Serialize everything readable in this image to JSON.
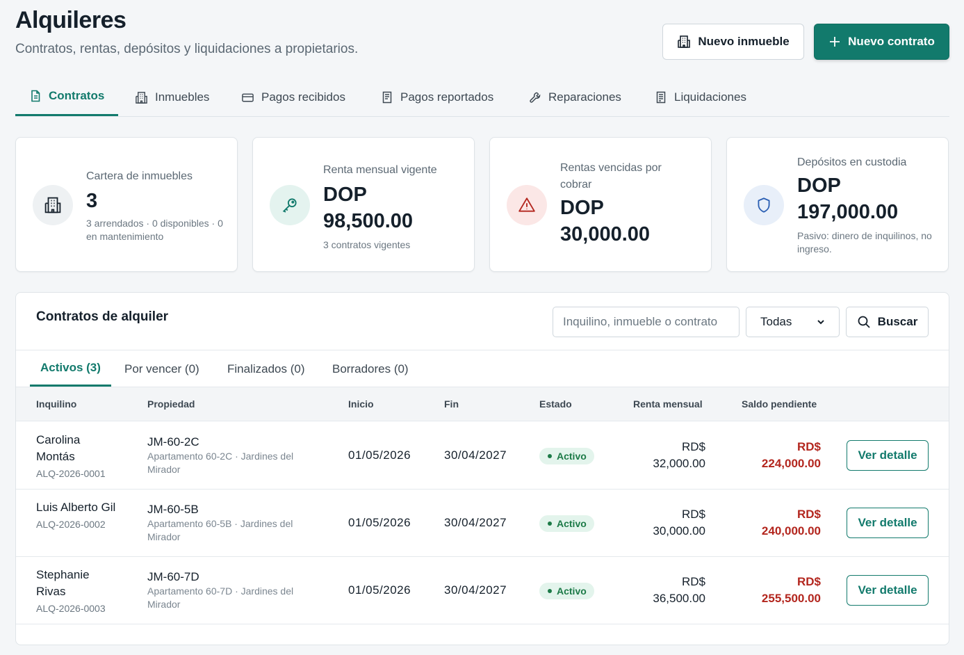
{
  "header": {
    "title": "Alquileres",
    "subtitle": "Contratos, rentas, depósitos y liquidaciones a propietarios.",
    "new_property_label": "Nuevo inmueble",
    "new_contract_label": "Nuevo contrato"
  },
  "tabs": [
    {
      "label": "Contratos",
      "icon": "document-icon",
      "active": true
    },
    {
      "label": "Inmuebles",
      "icon": "building-icon",
      "active": false
    },
    {
      "label": "Pagos recibidos",
      "icon": "credit-card-icon",
      "active": false
    },
    {
      "label": "Pagos reportados",
      "icon": "receipt-icon",
      "active": false
    },
    {
      "label": "Reparaciones",
      "icon": "wrench-icon",
      "active": false
    },
    {
      "label": "Liquidaciones",
      "icon": "document-list-icon",
      "active": false
    }
  ],
  "cards": [
    {
      "label": "Cartera de inmuebles",
      "value": "3",
      "note": "3 arrendados · 0 disponibles · 0 en mantenimiento",
      "icon": "building-icon"
    },
    {
      "label": "Renta mensual vigente",
      "value": "DOP 98,500.00",
      "note": "3 contratos vigentes",
      "icon": "key-icon"
    },
    {
      "label": "Rentas vencidas por cobrar",
      "value": "DOP 30,000.00",
      "note": "",
      "icon": "warning-icon"
    },
    {
      "label": "Depósitos en custodia",
      "value": "DOP 197,000.00",
      "note": "Pasivo: dinero de inquilinos, no ingreso.",
      "icon": "shield-icon"
    }
  ],
  "contracts_panel": {
    "title": "Contratos de alquiler",
    "search_placeholder": "Inquilino, inmueble o contrato",
    "filter_value": "Todas",
    "search_button": "Buscar",
    "subtabs": [
      {
        "label": "Activos (3)",
        "active": true
      },
      {
        "label": "Por vencer (0)",
        "active": false
      },
      {
        "label": "Finalizados (0)",
        "active": false
      },
      {
        "label": "Borradores (0)",
        "active": false
      }
    ],
    "columns": [
      "Inquilino",
      "Propiedad",
      "Inicio",
      "Fin",
      "Estado",
      "Renta mensual",
      "Saldo pendiente"
    ],
    "rows": [
      {
        "tenant": "Carolina Montás",
        "code": "ALQ-2026-0001",
        "property": "JM-60-2C",
        "property_desc": "Apartamento 60-2C · Jardines del Mirador",
        "start": "01/05/2026",
        "end": "30/04/2027",
        "status": "Activo",
        "rent_currency": "RD$",
        "rent": "32,000.00",
        "balance_currency": "RD$",
        "balance": "224,000.00",
        "action": "Ver detalle"
      },
      {
        "tenant": "Luis Alberto Gil",
        "code": "ALQ-2026-0002",
        "property": "JM-60-5B",
        "property_desc": "Apartamento 60-5B · Jardines del Mirador",
        "start": "01/05/2026",
        "end": "30/04/2027",
        "status": "Activo",
        "rent_currency": "RD$",
        "rent": "30,000.00",
        "balance_currency": "RD$",
        "balance": "240,000.00",
        "action": "Ver detalle"
      },
      {
        "tenant": "Stephanie Rivas",
        "code": "ALQ-2026-0003",
        "property": "JM-60-7D",
        "property_desc": "Apartamento 60-7D · Jardines del Mirador",
        "start": "01/05/2026",
        "end": "30/04/2027",
        "status": "Activo",
        "rent_currency": "RD$",
        "rent": "36,500.00",
        "balance_currency": "RD$",
        "balance": "255,500.00",
        "action": "Ver detalle"
      }
    ]
  },
  "colors": {
    "accent": "#127a6c",
    "danger": "#b3261e",
    "success": "#1c7a47"
  }
}
